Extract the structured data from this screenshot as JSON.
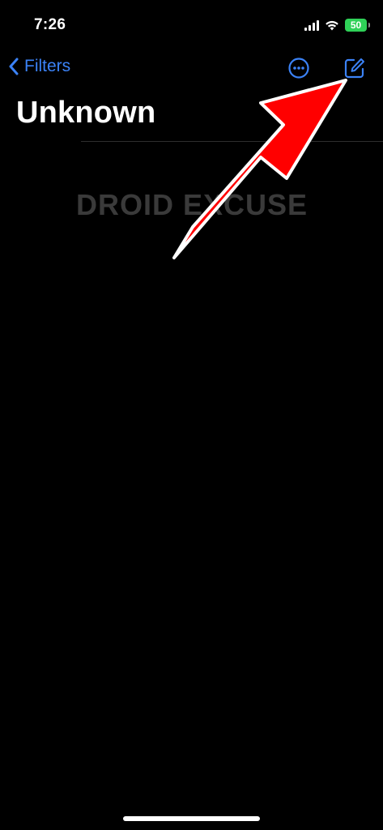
{
  "status_bar": {
    "time": "7:26",
    "battery_level": "50",
    "icons": [
      "signal-icon",
      "wifi-icon",
      "battery-charging-icon"
    ]
  },
  "nav": {
    "back_label": "Filters",
    "back_icon": "chevron-left-icon",
    "more_icon": "ellipsis-circle-icon",
    "compose_icon": "compose-icon"
  },
  "page": {
    "title": "Unknown"
  },
  "watermark": {
    "text": "DROID EXCUSE"
  },
  "annotation": {
    "type": "arrow",
    "color": "#ff0000",
    "points_to": "compose-button"
  },
  "colors": {
    "accent": "#3b82f6",
    "background": "#000000",
    "battery": "#2fd158"
  }
}
